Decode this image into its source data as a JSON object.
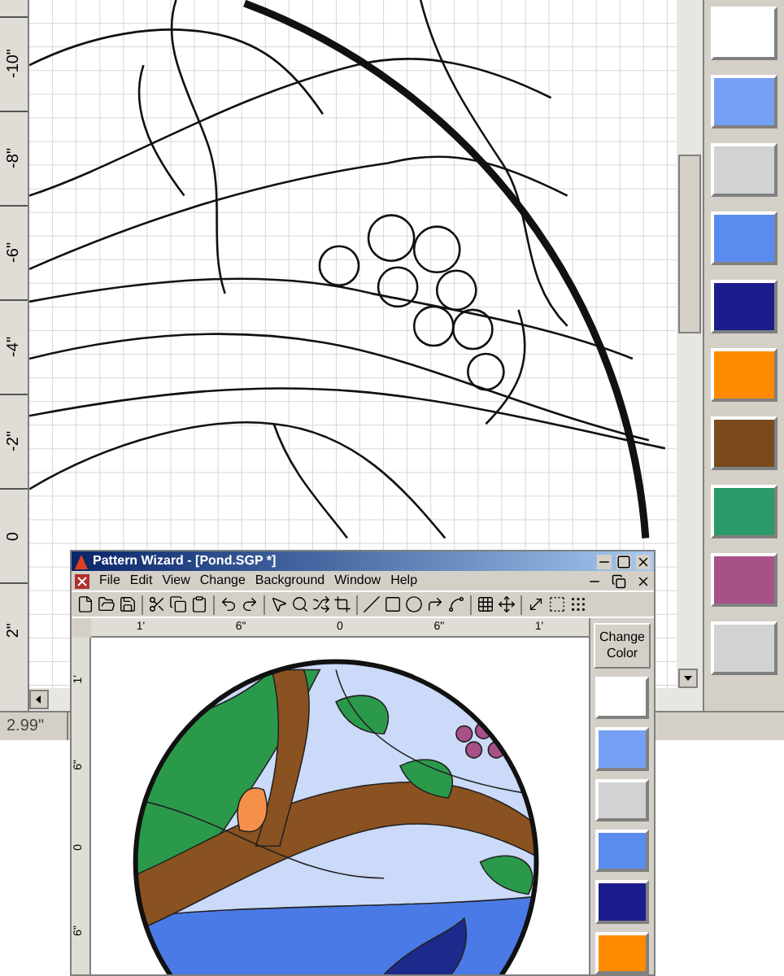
{
  "back_window": {
    "ruler_labels": [
      "-10\"",
      "-8\"",
      "-6\"",
      "-4\"",
      "-2\"",
      "0",
      "2\""
    ],
    "palette": [
      {
        "color": "#ffffff"
      },
      {
        "color": "#76a0f4"
      },
      {
        "color": "#d2d2d2"
      },
      {
        "color": "#5a8cf0"
      },
      {
        "color": "#1c1c8c"
      },
      {
        "color": "#ff8c00"
      },
      {
        "color": "#7a4a1c"
      },
      {
        "color": "#2a9a6a"
      },
      {
        "color": "#a85088"
      },
      {
        "color": "#d2d2d2"
      }
    ],
    "status": "2.99\""
  },
  "front_window": {
    "title": "Pattern Wizard - [Pond.SGP *]",
    "menu": [
      "File",
      "Edit",
      "View",
      "Change",
      "Background",
      "Window",
      "Help"
    ],
    "h_ruler": [
      "1'",
      "6\"",
      "0",
      "6\"",
      "1'"
    ],
    "v_ruler": [
      "1'",
      "6\"",
      "0",
      "6\""
    ],
    "change_color": "Change Color",
    "palette": [
      {
        "color": "#ffffff"
      },
      {
        "color": "#76a0f4"
      },
      {
        "color": "#d2d2d2"
      },
      {
        "color": "#5a8cf0"
      },
      {
        "color": "#1c1c8c"
      },
      {
        "color": "#ff8c00"
      }
    ]
  }
}
